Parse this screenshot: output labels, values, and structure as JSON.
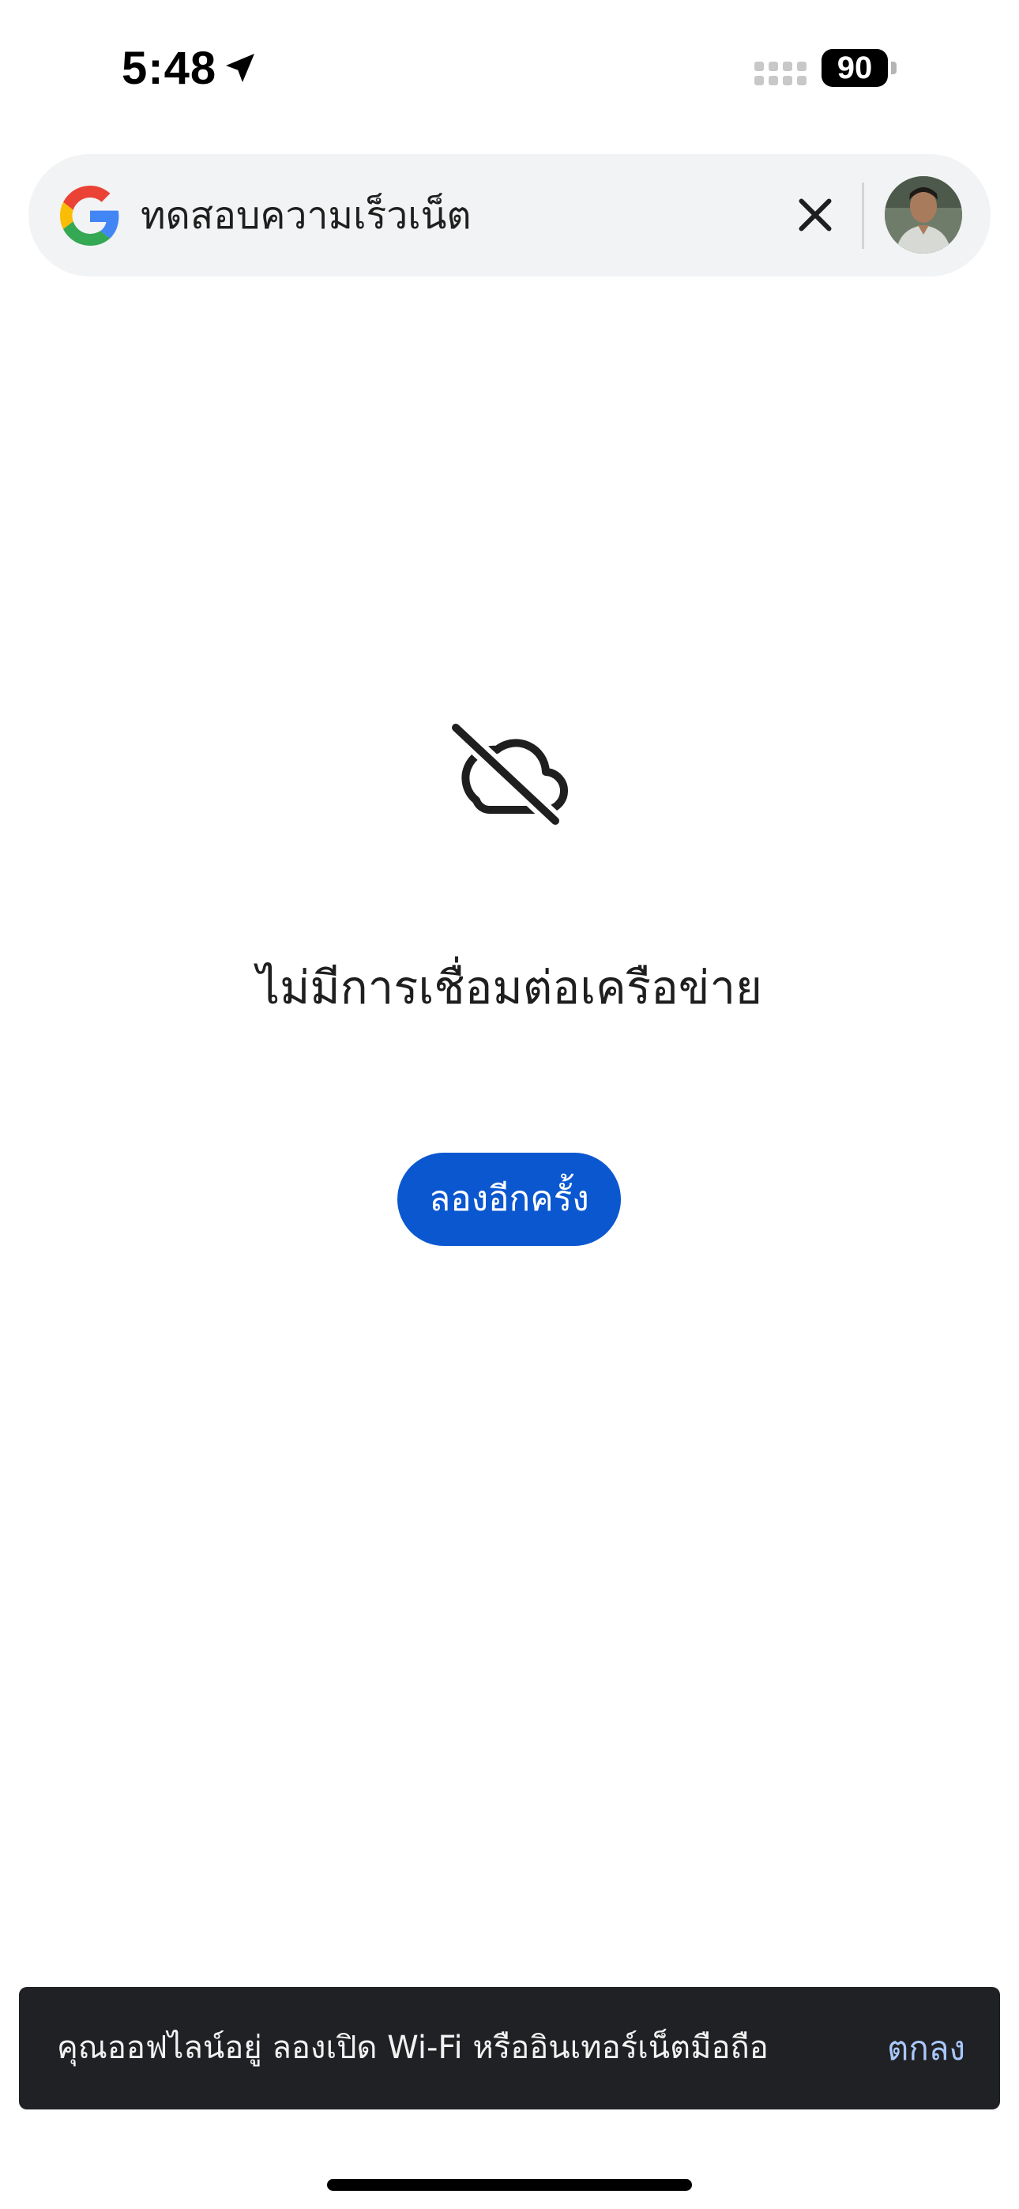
{
  "status_bar": {
    "time": "5:48",
    "battery_level": "90",
    "icons": [
      "location-arrow-icon",
      "cellular-signal-icon",
      "battery-icon"
    ]
  },
  "search": {
    "query": "ทดสอบความเร็วเน็ต",
    "icons": [
      "google-g-logo",
      "close-icon",
      "avatar"
    ]
  },
  "offline": {
    "icon": "cloud-off-icon",
    "message": "ไม่มีการเชื่อมต่อเครือข่าย",
    "retry_label": "ลองอีกครั้ง"
  },
  "snackbar": {
    "text": "คุณออฟไลน์อยู่ ลองเปิด Wi-Fi หรืออินเทอร์เน็ตมือถือ",
    "action_label": "ตกลง"
  },
  "colors": {
    "search_bar_bg": "#f1f3f4",
    "primary_button": "#0b57d0",
    "snackbar_bg": "#202124",
    "snackbar_action": "#a8c7fa"
  }
}
